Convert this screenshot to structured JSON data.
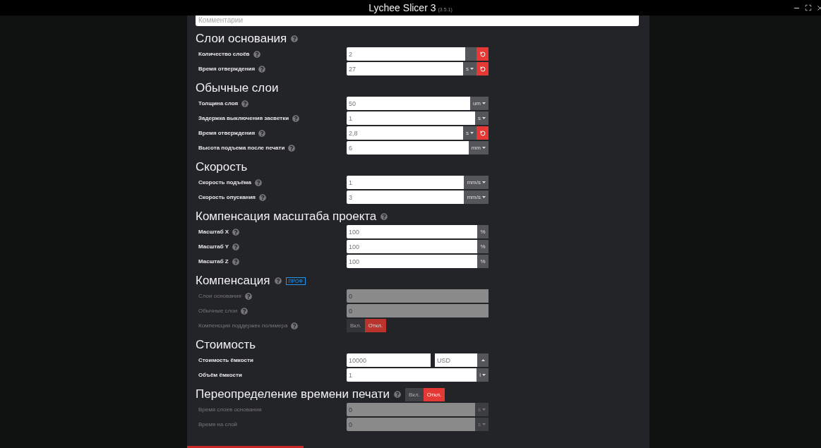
{
  "window": {
    "title": "Lychee Slicer 3",
    "version": "(3.5.1)"
  },
  "comment": {
    "placeholder": "Комментарии"
  },
  "sections": [
    {
      "title": "Слои основания",
      "help": true,
      "rows": [
        {
          "kind": "input",
          "label": "Количество слоёв",
          "help": true,
          "disabled": false,
          "value": "2",
          "blank_addon": true,
          "dropdown": false,
          "reset": true
        },
        {
          "kind": "input",
          "label": "Время отверждения",
          "help": true,
          "disabled": false,
          "value": "27",
          "unit": "s",
          "dropdown": true,
          "reset": true
        }
      ]
    },
    {
      "title": "Обычные слои",
      "help": false,
      "rows": [
        {
          "kind": "input",
          "label": "Толщина слоя",
          "help": true,
          "disabled": false,
          "value": "50",
          "unit": "um",
          "dropdown": true,
          "reset": false
        },
        {
          "kind": "input",
          "label": "Задержка выключения засветки",
          "help": true,
          "disabled": false,
          "value": "1",
          "unit": "s",
          "dropdown": true,
          "reset": false
        },
        {
          "kind": "input",
          "label": "Время отверждения",
          "help": true,
          "disabled": false,
          "value": "2,8",
          "unit": "s",
          "dropdown": true,
          "reset": true
        },
        {
          "kind": "input",
          "label": "Высота подъема после печати",
          "help": true,
          "disabled": false,
          "value": "6",
          "unit": "mm",
          "dropdown": true,
          "reset": false
        }
      ]
    },
    {
      "title": "Скорость",
      "help": false,
      "rows": [
        {
          "kind": "input",
          "label": "Скорость подъёма",
          "help": true,
          "disabled": false,
          "value": "1",
          "unit": "mm/s",
          "dropdown": true,
          "reset": false
        },
        {
          "kind": "input",
          "label": "Скорость опускания",
          "help": true,
          "disabled": false,
          "value": "3",
          "unit": "mm/s",
          "dropdown": true,
          "reset": false
        }
      ]
    },
    {
      "title": "Компенсация масштаба проекта",
      "help": true,
      "rows": [
        {
          "kind": "input",
          "label": "Масштаб X",
          "help": true,
          "disabled": false,
          "value": "100",
          "unit": "%",
          "dropdown": false,
          "reset": false
        },
        {
          "kind": "input",
          "label": "Масштаб Y",
          "help": true,
          "disabled": false,
          "value": "100",
          "unit": "%",
          "dropdown": false,
          "reset": false
        },
        {
          "kind": "input",
          "label": "Масштаб Z",
          "help": true,
          "disabled": false,
          "value": "100",
          "unit": "%",
          "dropdown": false,
          "reset": false
        }
      ]
    },
    {
      "title": "Компенсация",
      "help": true,
      "badge": "ПРОФ",
      "rows": [
        {
          "kind": "input",
          "label": "Слои основания",
          "help": true,
          "disabled": true,
          "value": "0",
          "dropdown": false,
          "reset": false
        },
        {
          "kind": "input",
          "label": "Обычные слои",
          "help": true,
          "disabled": true,
          "value": "0",
          "dropdown": false,
          "reset": false
        },
        {
          "kind": "toggle",
          "label": "Компенсция поддержек полимера",
          "help": true,
          "disabled": true,
          "options": [
            {
              "label": "Вкл.",
              "selected": false
            },
            {
              "label": "Откл.",
              "selected": true
            }
          ]
        }
      ]
    },
    {
      "title": "Стоимость",
      "help": false,
      "rows": [
        {
          "kind": "cost",
          "label": "Стоимость ёмкости",
          "help": false,
          "disabled": false,
          "value": "10000",
          "currency": "USD"
        },
        {
          "kind": "input",
          "label": "Объём ёмкости",
          "help": false,
          "disabled": false,
          "value": "1",
          "unit": "l",
          "dropdown": true,
          "reset": false
        }
      ]
    },
    {
      "title": "Переопределение времени печати",
      "help": true,
      "toggle": {
        "disabled": false,
        "options": [
          {
            "label": "Вкл.",
            "selected": false
          },
          {
            "label": "Откл.",
            "selected": true
          }
        ]
      },
      "rows": [
        {
          "kind": "input",
          "label": "Время слоев основания",
          "help": false,
          "disabled": true,
          "value": "0",
          "unit": "s",
          "dropdown": true,
          "reset": false
        },
        {
          "kind": "input",
          "label": "Время на слой",
          "help": false,
          "disabled": true,
          "value": "0",
          "unit": "s",
          "dropdown": true,
          "reset": false
        }
      ]
    }
  ]
}
